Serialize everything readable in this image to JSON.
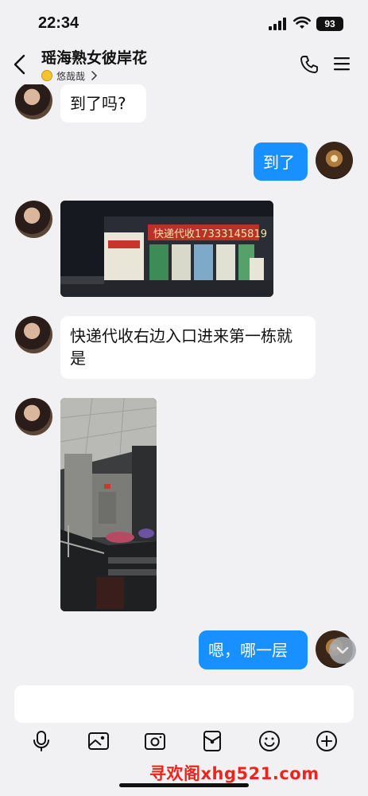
{
  "status_bar": {
    "time": "22:34",
    "battery": "93"
  },
  "header": {
    "title": "瑶海熟女彼岸花",
    "subtitle_name": "悠哉哉"
  },
  "messages": [
    {
      "side": "in",
      "type": "text",
      "text": "到了吗?"
    },
    {
      "side": "out",
      "type": "text",
      "text": "到了"
    },
    {
      "side": "in",
      "type": "image",
      "description_text": "快递代收17333145819"
    },
    {
      "side": "in",
      "type": "text",
      "text": "快递代收右边入口进来第一栋就是"
    },
    {
      "side": "in",
      "type": "image"
    },
    {
      "side": "out",
      "type": "text",
      "text": "嗯，哪一层"
    }
  ],
  "input": {
    "placeholder": ""
  },
  "toolbar": [
    "mic-icon",
    "image-icon",
    "camera-icon",
    "redpacket-icon",
    "emoji-icon",
    "plus-icon"
  ],
  "watermark": "寻欢阁xhg521.com",
  "colors": {
    "outgoing_bubble": "#1890ff",
    "background": "#f1f1f3",
    "watermark": "#e8261d"
  }
}
